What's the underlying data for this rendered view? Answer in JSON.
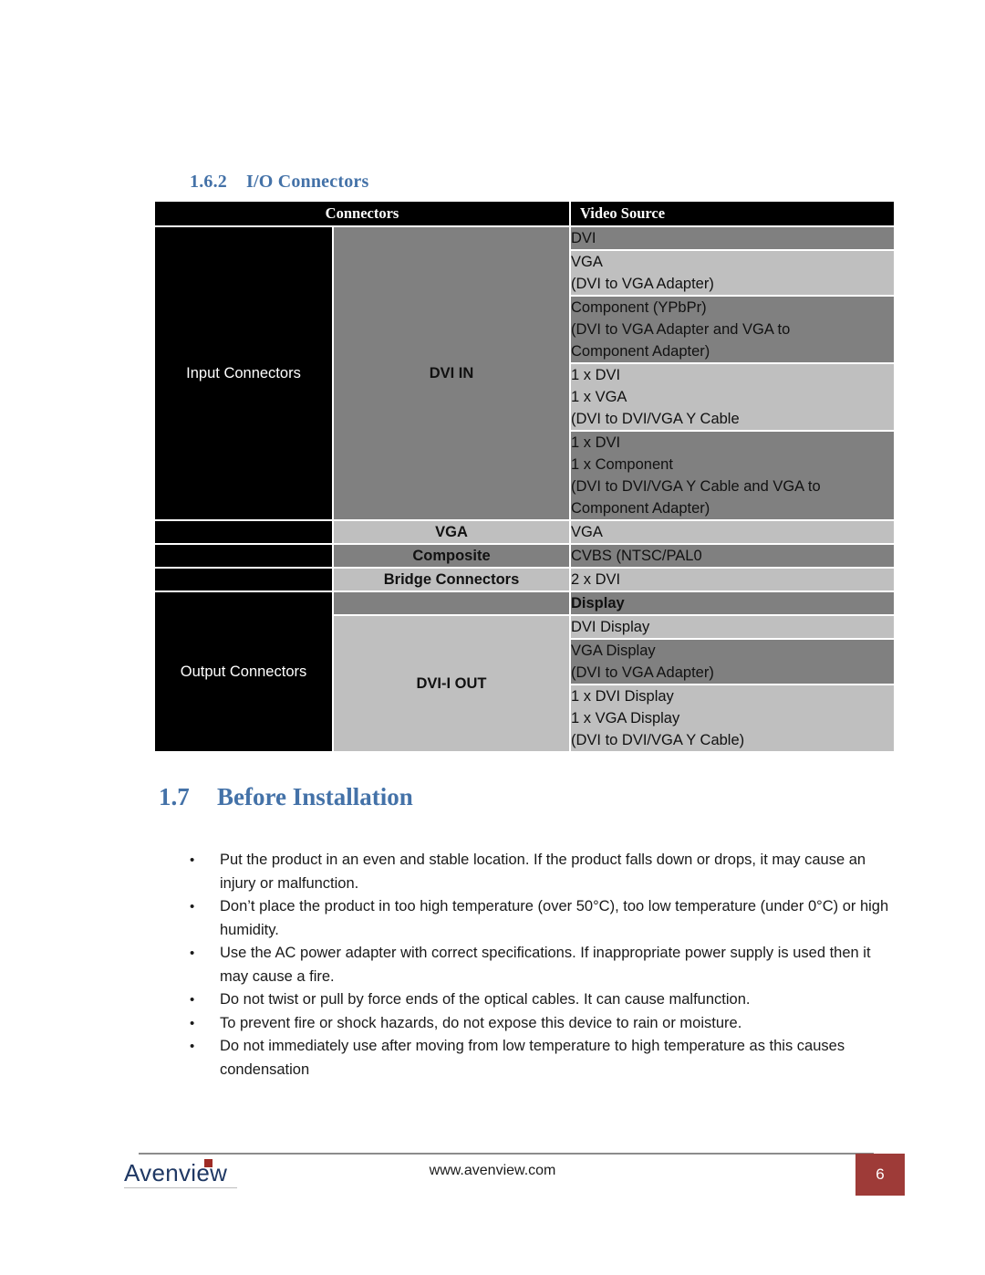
{
  "document": {
    "section_1_6_2": {
      "number": "1.6.2",
      "title": "I/O Connectors"
    },
    "section_1_7": {
      "number": "1.7",
      "title": "Before Installation"
    }
  },
  "io_table": {
    "headers": {
      "group": "Connectors",
      "source": "Video Source"
    },
    "groups": [
      {
        "label": "Input Connectors",
        "rows": [
          {
            "connector": "DVI IN",
            "connector_rowspan": 5,
            "entries": [
              {
                "shade": "dark",
                "lines": [
                  "DVI"
                ]
              },
              {
                "shade": "light",
                "lines": [
                  "VGA",
                  "(DVI to VGA Adapter)"
                ]
              },
              {
                "shade": "dark",
                "lines": [
                  "Component (YPbPr)",
                  "(DVI to VGA Adapter and VGA to",
                  "Component Adapter)"
                ]
              },
              {
                "shade": "light",
                "lines": [
                  "1 x DVI",
                  "1 x VGA",
                  "(DVI to DVI/VGA Y Cable"
                ]
              },
              {
                "shade": "dark",
                "lines": [
                  "1 x DVI",
                  "1 x Component",
                  "(DVI to DVI/VGA Y Cable and VGA to",
                  "Component Adapter)"
                ]
              }
            ]
          },
          {
            "connector": "VGA",
            "connector_shade": "light",
            "entries": [
              {
                "shade": "light",
                "lines": [
                  "VGA"
                ]
              }
            ]
          },
          {
            "connector": "Composite",
            "connector_shade": "dark",
            "entries": [
              {
                "shade": "dark",
                "lines": [
                  "CVBS (NTSC/PAL0"
                ]
              }
            ]
          },
          {
            "connector": "Bridge Connectors",
            "connector_shade": "light",
            "entries": [
              {
                "shade": "light",
                "lines": [
                  "2 x DVI"
                ]
              }
            ]
          }
        ]
      },
      {
        "label": "Output Connectors",
        "rows": [
          {
            "connector": "",
            "connector_shade": "dark",
            "entries": [
              {
                "shade": "dark",
                "bold": true,
                "lines": [
                  "Display"
                ]
              }
            ]
          },
          {
            "connector": "DVI-I OUT",
            "connector_rowspan": 3,
            "connector_shade": "light",
            "entries": [
              {
                "shade": "light",
                "lines": [
                  "DVI Display"
                ]
              },
              {
                "shade": "dark",
                "lines": [
                  "VGA Display",
                  "(DVI to VGA Adapter)"
                ]
              },
              {
                "shade": "light",
                "lines": [
                  "1 x DVI Display",
                  "1 x VGA Display",
                  "(DVI to DVI/VGA Y Cable)"
                ]
              }
            ]
          }
        ]
      }
    ]
  },
  "before_installation": {
    "bullets": [
      "Put the product in an even and stable location. If the product falls down or drops, it may cause an injury or malfunction.",
      "Don’t place the product in too high temperature (over 50°C), too low temperature (under 0°C) or high humidity.",
      "Use the AC power adapter with correct specifications. If inappropriate power supply is used then it may cause a fire.",
      "Do not twist or pull by force ends of the optical cables. It can cause malfunction.",
      "To prevent fire or shock hazards, do not expose this device to rain or moisture.",
      "Do not immediately use after moving from low temperature to high temperature as this causes condensation"
    ],
    "bullet_glyph": "•"
  },
  "footer": {
    "logo_text": "Avenview",
    "url": "www.avenview.com",
    "page_number": "6"
  },
  "colors": {
    "heading_blue": "#4472A8",
    "table_dark_gray": "#808080",
    "table_light_gray": "#BFBFBF",
    "table_header_black": "#000000",
    "page_badge_red": "#9E3B38",
    "logo_navy": "#1F3864",
    "logo_accent_red": "#9E2B25"
  }
}
